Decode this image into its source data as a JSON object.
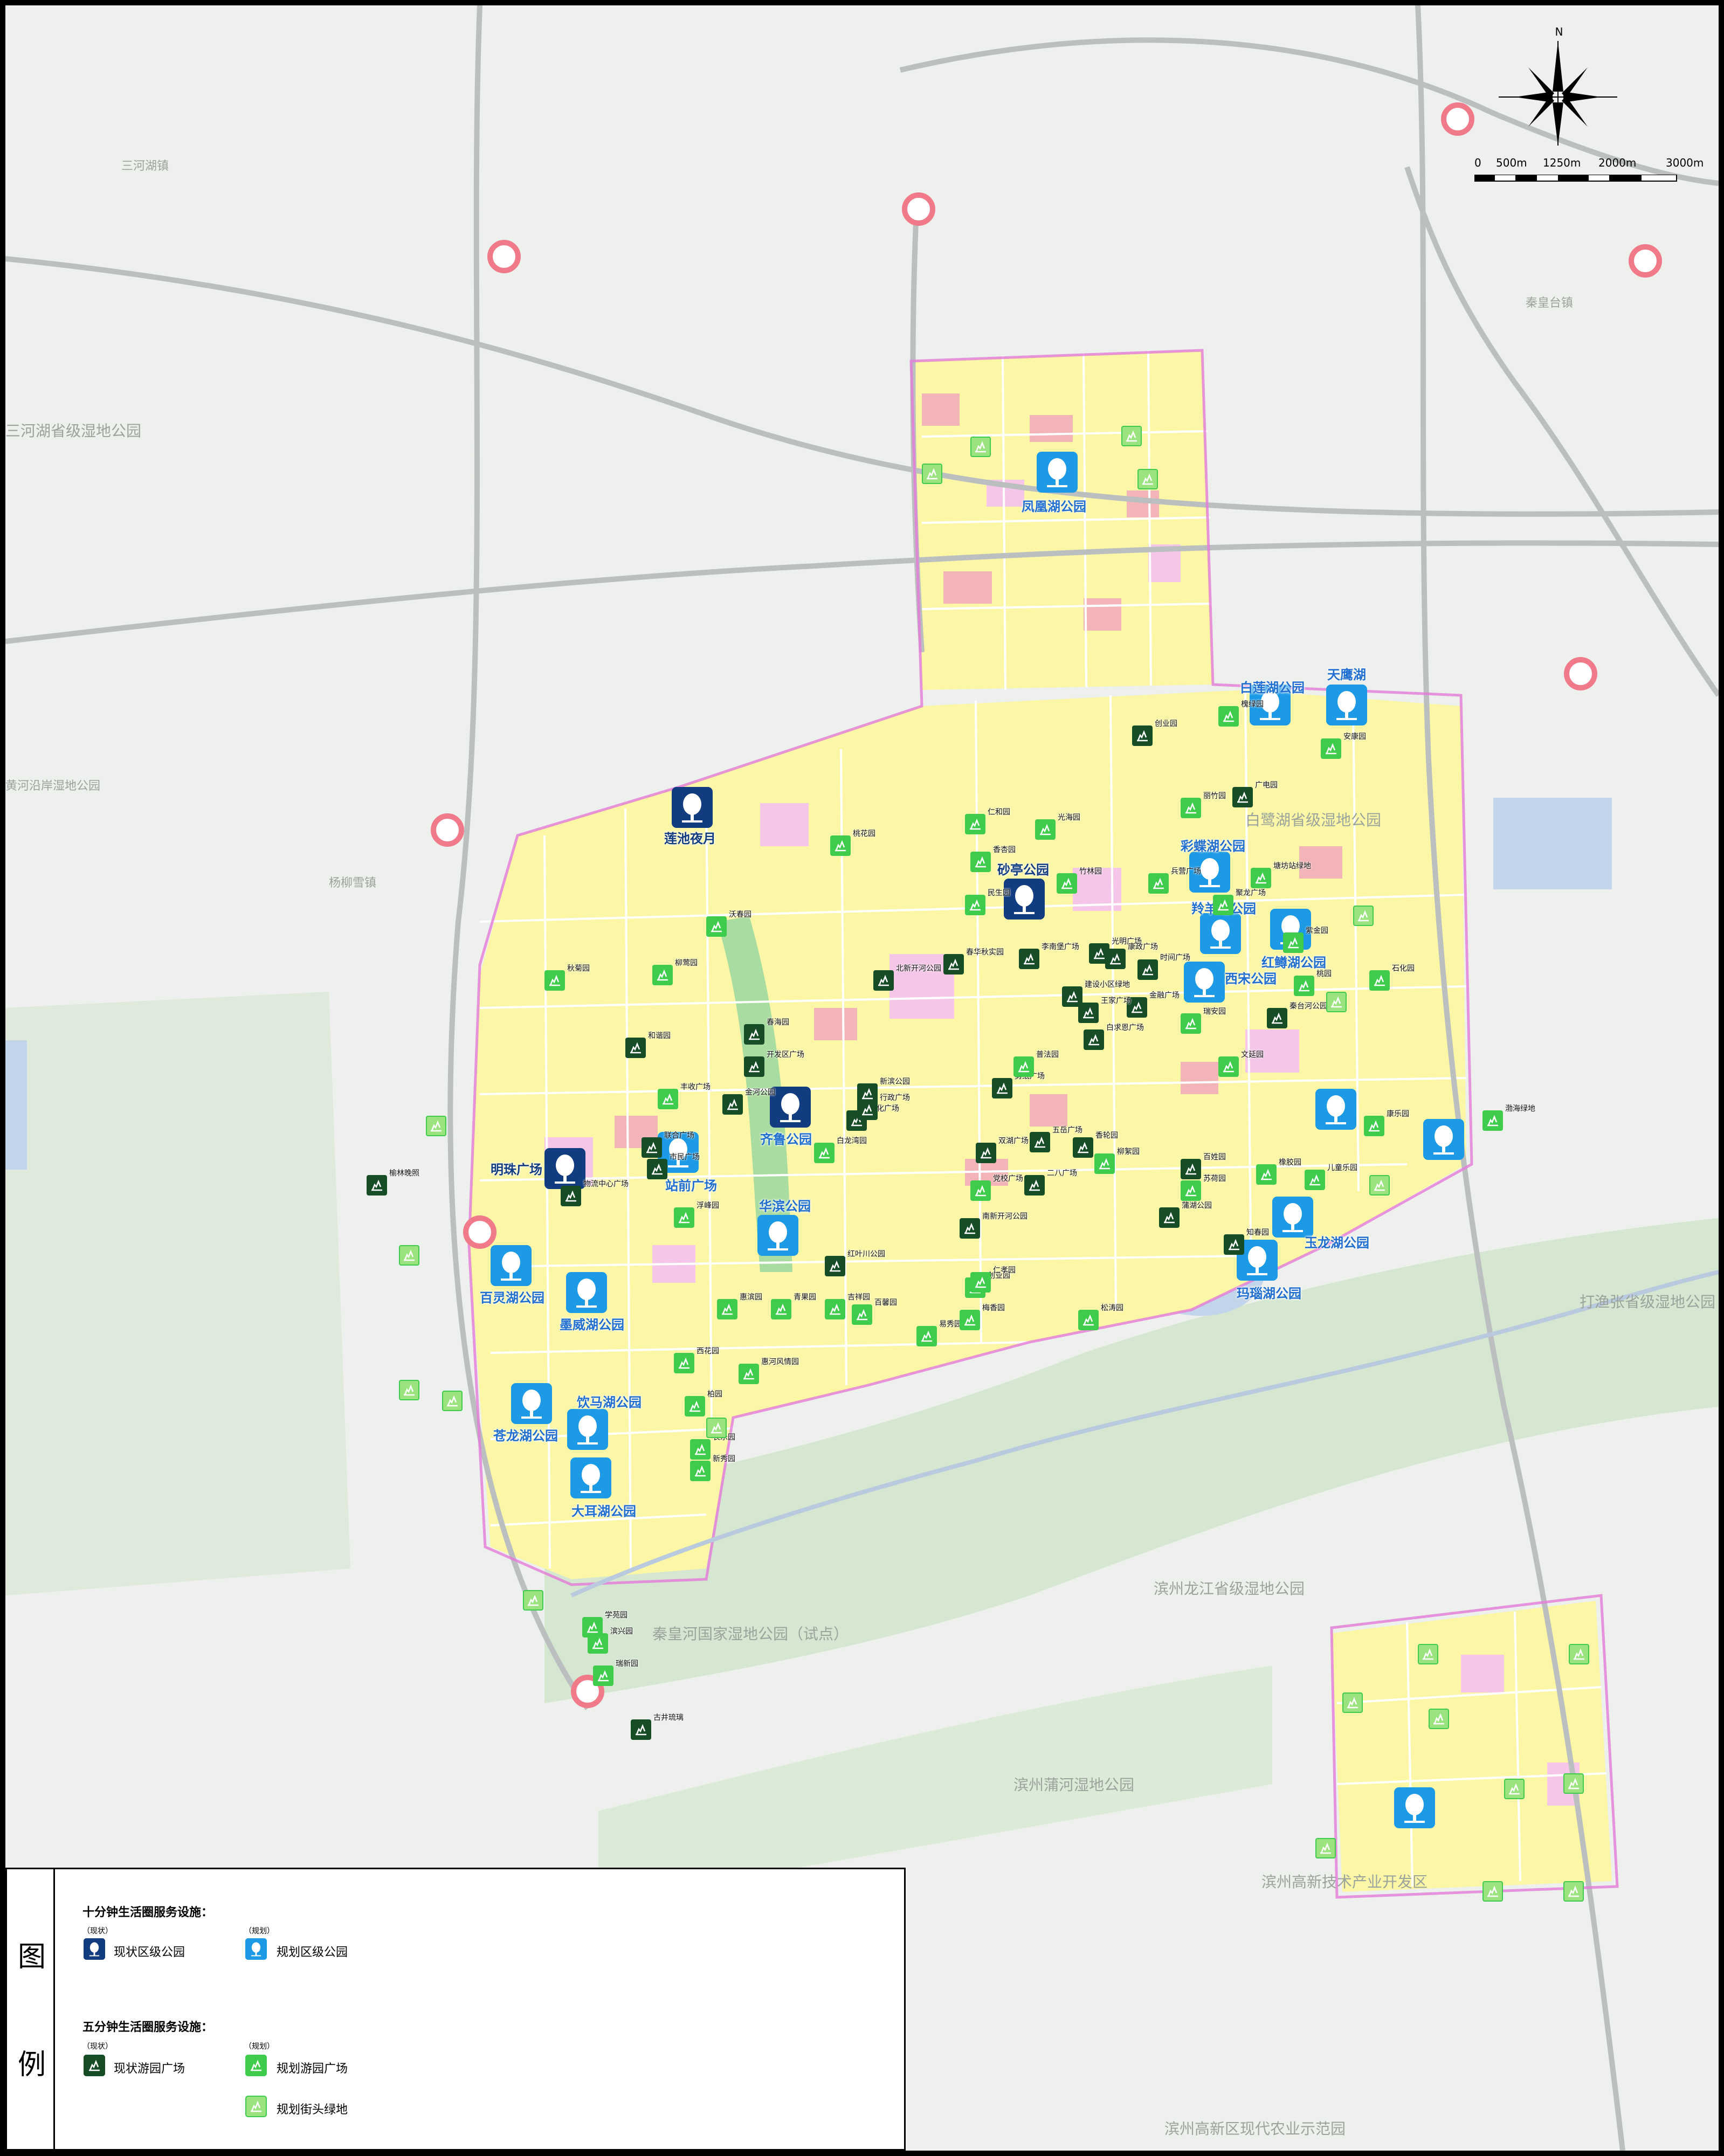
{
  "map": {
    "colors": {
      "residential": "#fbf7a6",
      "commercial": "#f3b4b7",
      "public": "#f6c6e8",
      "green": "#a9dca0",
      "water": "#c3d5ea",
      "expressway": "#bcbfc0",
      "boundary": "#e47ad8",
      "interchange": "#f07a8a",
      "marker_current": "#123c80",
      "marker_planned": "#1c9ae6",
      "square_current": "#174d26",
      "square_planned": "#3fcc4d"
    },
    "place_names": [
      "三河湖镇",
      "三河湖省级湿地公园",
      "黄河沿岸湿地公园",
      "杨柳雪镇",
      "秦皇台镇",
      "白鹭湖省级湿地公园",
      "打渔张省级湿地公园",
      "滨州龙江省级湿地公园",
      "秦皇河国家湿地公园（试点）",
      "滨州蒲河湿地公园",
      "滨州高新技术产业开发区",
      "滨州高新区现代农业示范园"
    ],
    "district_parks": [
      {
        "name": "凤凰湖公园",
        "status": "planned"
      },
      {
        "name": "白莲湖公园",
        "status": "planned"
      },
      {
        "name": "天鹰湖",
        "status": "planned"
      },
      {
        "name": "莲池夜月",
        "status": "current"
      },
      {
        "name": "砂亭公园",
        "status": "current"
      },
      {
        "name": "彩蝶湖公园",
        "status": "planned"
      },
      {
        "name": "羚羊湖公园",
        "status": "planned"
      },
      {
        "name": "红鳟湖公园",
        "status": "planned"
      },
      {
        "name": "西宋公园",
        "status": "planned"
      },
      {
        "name": "明珠广场",
        "status": "current"
      },
      {
        "name": "齐鲁公园",
        "status": "current"
      },
      {
        "name": "站前广场",
        "status": "planned"
      },
      {
        "name": "华滨公园",
        "status": "planned"
      },
      {
        "name": "百灵湖公园",
        "status": "planned"
      },
      {
        "name": "墨威湖公园",
        "status": "planned"
      },
      {
        "name": "饮马湖公园",
        "status": "planned"
      },
      {
        "name": "苍龙湖公园",
        "status": "planned"
      },
      {
        "name": "大耳湖公园",
        "status": "planned"
      },
      {
        "name": "玉龙湖公园",
        "status": "planned"
      },
      {
        "name": "玛瑙湖公园",
        "status": "planned"
      }
    ],
    "squares": [
      {
        "name": "创业园",
        "status": "current"
      },
      {
        "name": "广电园",
        "status": "current"
      },
      {
        "name": "春华秋实园",
        "status": "current"
      },
      {
        "name": "北新开河公园",
        "status": "current"
      },
      {
        "name": "李南堡广场",
        "status": "current"
      },
      {
        "name": "光明广场",
        "status": "current"
      },
      {
        "name": "时间广场",
        "status": "current"
      },
      {
        "name": "康政广场",
        "status": "current"
      },
      {
        "name": "建设小区绿地",
        "status": "current"
      },
      {
        "name": "金融广场",
        "status": "current"
      },
      {
        "name": "王家广场",
        "status": "current"
      },
      {
        "name": "白求恩广场",
        "status": "current"
      },
      {
        "name": "秦台河公园",
        "status": "current"
      },
      {
        "name": "和谐园",
        "status": "current"
      },
      {
        "name": "春海园",
        "status": "current"
      },
      {
        "name": "开发区广场",
        "status": "current"
      },
      {
        "name": "金河公园",
        "status": "current"
      },
      {
        "name": "新滨公园",
        "status": "current"
      },
      {
        "name": "文化广场",
        "status": "current"
      },
      {
        "name": "行政广场",
        "status": "current"
      },
      {
        "name": "联合广场",
        "status": "current"
      },
      {
        "name": "市民广场",
        "status": "current"
      },
      {
        "name": "物流中心广场",
        "status": "current"
      },
      {
        "name": "剪纸广场",
        "status": "current"
      },
      {
        "name": "五岳广场",
        "status": "current"
      },
      {
        "name": "双湖广场",
        "status": "current"
      },
      {
        "name": "二八广场",
        "status": "current"
      },
      {
        "name": "香轮园",
        "status": "current"
      },
      {
        "name": "百姓园",
        "status": "current"
      },
      {
        "name": "蒲湖公园",
        "status": "current"
      },
      {
        "name": "知春园",
        "status": "current"
      },
      {
        "name": "南新开河公园",
        "status": "current"
      },
      {
        "name": "红叶川公园",
        "status": "current"
      },
      {
        "name": "榆林晚照",
        "status": "current"
      },
      {
        "name": "古井琉璃",
        "status": "current"
      },
      {
        "name": "槐绿园",
        "status": "planned"
      },
      {
        "name": "安康园",
        "status": "planned"
      },
      {
        "name": "丽竹园",
        "status": "planned"
      },
      {
        "name": "桃花园",
        "status": "planned"
      },
      {
        "name": "仁和园",
        "status": "planned"
      },
      {
        "name": "光海园",
        "status": "planned"
      },
      {
        "name": "香杏园",
        "status": "planned"
      },
      {
        "name": "民生园",
        "status": "planned"
      },
      {
        "name": "竹林园",
        "status": "planned"
      },
      {
        "name": "兵营广场",
        "status": "planned"
      },
      {
        "name": "塘坊站绿地",
        "status": "planned"
      },
      {
        "name": "紫金园",
        "status": "planned"
      },
      {
        "name": "沃春园",
        "status": "planned"
      },
      {
        "name": "柳莺园",
        "status": "planned"
      },
      {
        "name": "秋菊园",
        "status": "planned"
      },
      {
        "name": "聚龙广场",
        "status": "planned"
      },
      {
        "name": "桃园",
        "status": "planned"
      },
      {
        "name": "石化园",
        "status": "planned"
      },
      {
        "name": "瑞安园",
        "status": "planned"
      },
      {
        "name": "普法园",
        "status": "planned"
      },
      {
        "name": "文延园",
        "status": "planned"
      },
      {
        "name": "丰收广场",
        "status": "planned"
      },
      {
        "name": "白龙湾园",
        "status": "planned"
      },
      {
        "name": "党校广场",
        "status": "planned"
      },
      {
        "name": "柳絮园",
        "status": "planned"
      },
      {
        "name": "橡胶园",
        "status": "planned"
      },
      {
        "name": "儿童乐园",
        "status": "planned"
      },
      {
        "name": "康乐园",
        "status": "planned"
      },
      {
        "name": "苏荷园",
        "status": "planned"
      },
      {
        "name": "创业园",
        "status": "planned"
      },
      {
        "name": "浮峰园",
        "status": "planned"
      },
      {
        "name": "易秀园",
        "status": "planned"
      },
      {
        "name": "惠滨园",
        "status": "planned"
      },
      {
        "name": "青果园",
        "status": "planned"
      },
      {
        "name": "吉祥园",
        "status": "planned"
      },
      {
        "name": "百馨园",
        "status": "planned"
      },
      {
        "name": "仁孝园",
        "status": "planned"
      },
      {
        "name": "梅香园",
        "status": "planned"
      },
      {
        "name": "松涛园",
        "status": "planned"
      },
      {
        "name": "惠河风情园",
        "status": "planned"
      },
      {
        "name": "西花园",
        "status": "planned"
      },
      {
        "name": "柏园",
        "status": "planned"
      },
      {
        "name": "长乐园",
        "status": "planned"
      },
      {
        "name": "新秀园",
        "status": "planned"
      },
      {
        "name": "学苑园",
        "status": "planned"
      },
      {
        "name": "滨兴园",
        "status": "planned"
      },
      {
        "name": "瑞新园",
        "status": "planned"
      },
      {
        "name": "渤海绿地",
        "status": "planned"
      }
    ],
    "north_label": "N",
    "scale_labels": [
      "0",
      "500m",
      "1250m",
      "2000m",
      "3000m"
    ]
  },
  "legend": {
    "title_chars": [
      "图",
      "例"
    ],
    "ten_min_header": "十分钟生活圈服务设施：",
    "five_min_header": "五分钟生活圈服务设施：",
    "tag_current": "（现状）",
    "tag_planned": "（规划）",
    "items": {
      "current_park": "现状区级公园",
      "planned_park": "规划区级公园",
      "current_square": "现状游园广场",
      "planned_square": "规划游园广场",
      "planned_green": "规划街头绿地"
    }
  }
}
